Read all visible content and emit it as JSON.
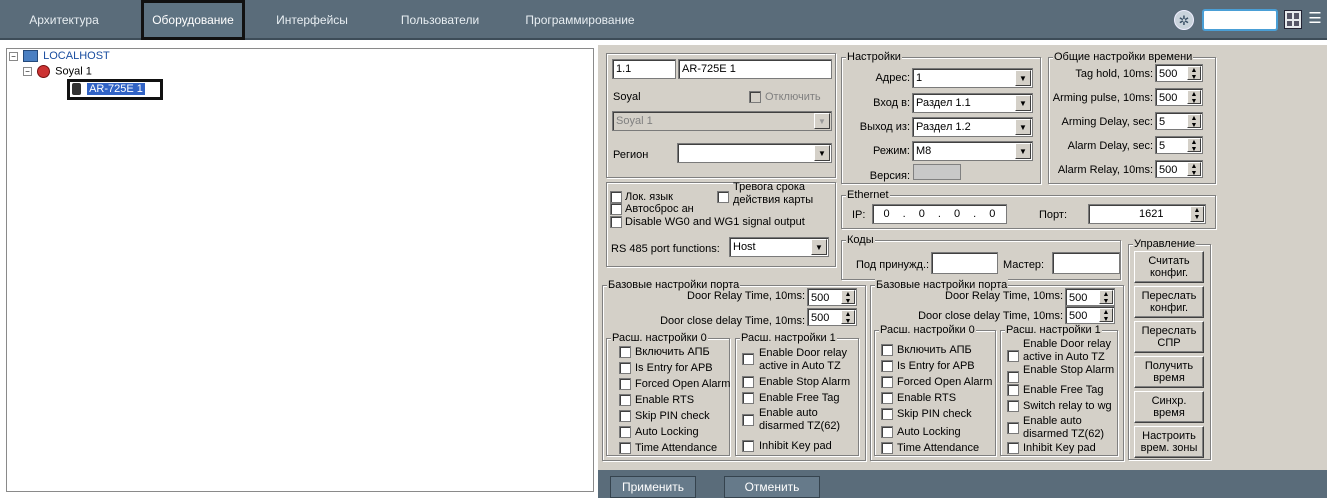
{
  "tabs": [
    "Архитектура",
    "Оборудование",
    "Интерфейсы",
    "Пользователи",
    "Программирование"
  ],
  "tree": {
    "root": "LOCALHOST",
    "child": "Soyal 1",
    "leaf": "AR-725E 1"
  },
  "device": {
    "num": "1.1",
    "name": "AR-725E 1",
    "type": "Soyal",
    "disable": "Отключить",
    "parent": "Soyal 1",
    "region_label": "Регион",
    "region": ""
  },
  "settings": {
    "legend": "Настройки",
    "addr_label": "Адрес:",
    "addr": "1",
    "in_label": "Вход в:",
    "in": "Раздел 1.1",
    "out_label": "Выход из:",
    "out": "Раздел 1.2",
    "mode_label": "Режим:",
    "mode": "M8",
    "ver_label": "Версия:"
  },
  "timing": {
    "legend": "Общие настройки времени",
    "rows": [
      {
        "label": "Tag hold, 10ms:",
        "value": "500"
      },
      {
        "label": "Arming pulse, 10ms:",
        "value": "500"
      },
      {
        "label": "Arming Delay, sec:",
        "value": "5"
      },
      {
        "label": "Alarm Delay, sec:",
        "value": "5"
      },
      {
        "label": "Alarm Relay, 10ms:",
        "value": "500"
      }
    ]
  },
  "opts": {
    "lok": "Лок. язык",
    "alarm_card": "Тревога срока действия карты",
    "autoreset": "Автосброс ан",
    "disable_wg": "Disable WG0 and WG1 signal output",
    "rs485_label": "RS 485 port functions:",
    "rs485": "Host"
  },
  "ethernet": {
    "legend": "Ethernet",
    "ip_label": "IP:",
    "ip": [
      "0",
      "0",
      "0",
      "0"
    ],
    "port_label": "Порт:",
    "port": "1621"
  },
  "codes": {
    "legend": "Коды",
    "duress_label": "Под принужд.:",
    "master_label": "Мастер:"
  },
  "control": {
    "legend": "Управление",
    "buttons": [
      "Считать конфиг.",
      "Переслать конфиг.",
      "Переслать СПР",
      "Получить время",
      "Синхр. время",
      "Настроить врем. зоны"
    ]
  },
  "port0": {
    "legend": "Базовые настройки порта",
    "relay_label": "Door Relay Time, 10ms:",
    "relay": "500",
    "close_label": "Door close delay Time, 10ms:",
    "close": "500",
    "ext0_legend": "Расш. настройки 0",
    "ext0": [
      "Включить АПБ",
      "Is Entry for APB",
      "Forced Open Alarm",
      "Enable RTS",
      "Skip PIN check",
      "Auto Locking",
      "Time Attendance"
    ],
    "ext1_legend": "Расш. настройки 1",
    "ext1": [
      "Enable Door relay active in Auto TZ",
      "Enable Stop Alarm",
      "Enable Free Tag",
      "Enable auto disarmed TZ(62)",
      "Inhibit Key pad"
    ]
  },
  "port1": {
    "legend": "Базовые настройки порта",
    "relay_label": "Door Relay Time, 10ms:",
    "relay": "500",
    "close_label": "Door close delay Time, 10ms:",
    "close": "500",
    "ext0_legend": "Расш. настройки 0",
    "ext0": [
      "Включить АПБ",
      "Is Entry for APB",
      "Forced Open Alarm",
      "Enable RTS",
      "Skip PIN check",
      "Auto Locking",
      "Time Attendance"
    ],
    "ext1_legend": "Расш. настройки 1",
    "ext1": [
      "Enable Door relay active in Auto TZ",
      "Enable Stop Alarm",
      "Enable Free Tag",
      "Switch relay to wg",
      "Enable auto disarmed TZ(62)",
      "Inhibit Key pad"
    ]
  },
  "footer": {
    "apply": "Применить",
    "cancel": "Отменить"
  }
}
